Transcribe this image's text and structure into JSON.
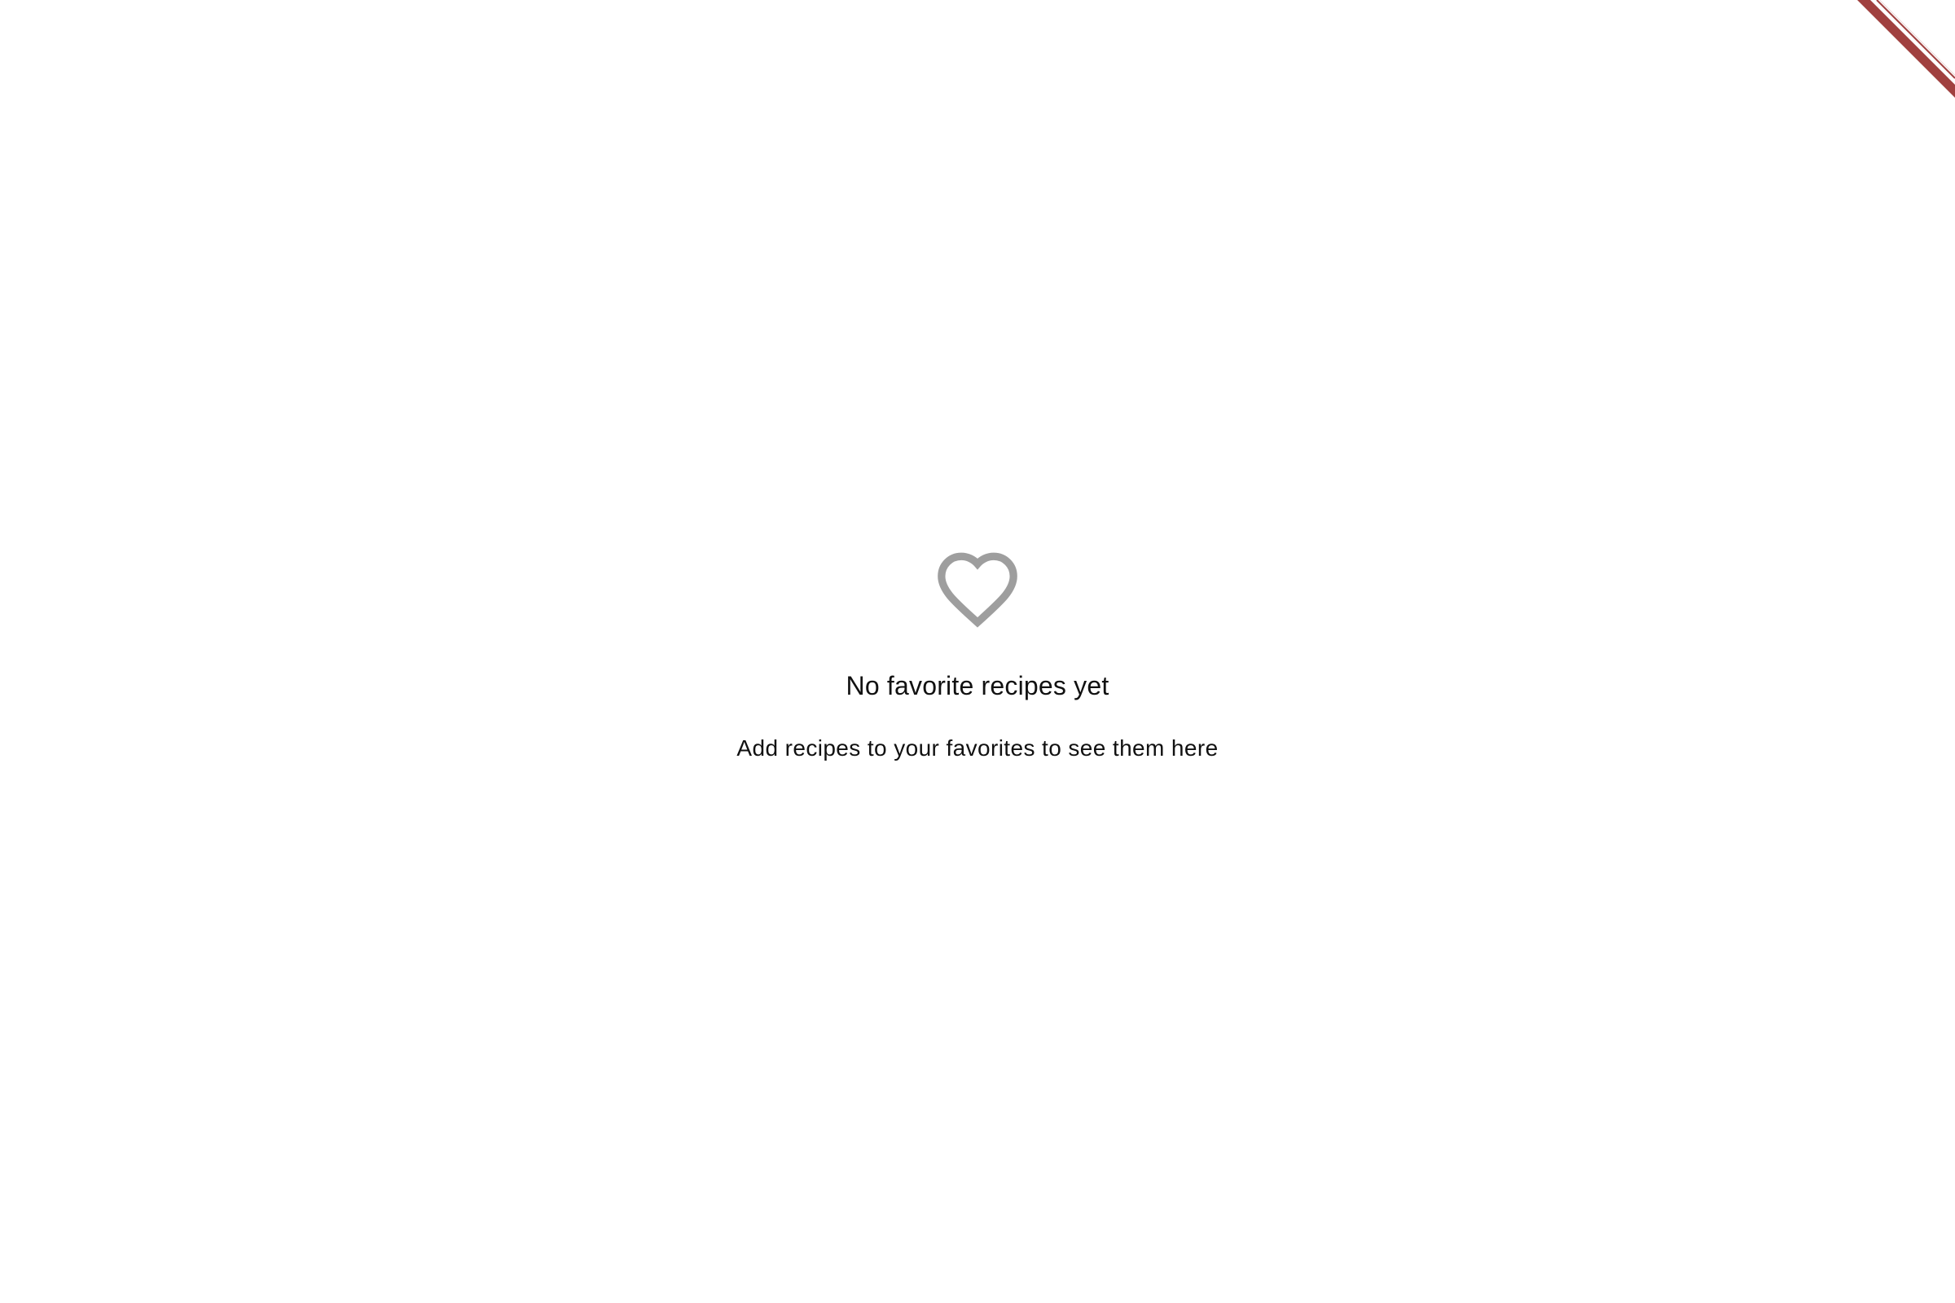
{
  "empty_state": {
    "icon": "heart-outline-icon",
    "title": "No favorite recipes yet",
    "subtitle": "Add recipes to your favorites to see them here"
  },
  "debug_banner": {
    "icon": "debug-ribbon"
  },
  "colors": {
    "background": "#ffffff",
    "text": "#111111",
    "heart_icon": "#9e9e9e",
    "ribbon": "#a0403f"
  }
}
